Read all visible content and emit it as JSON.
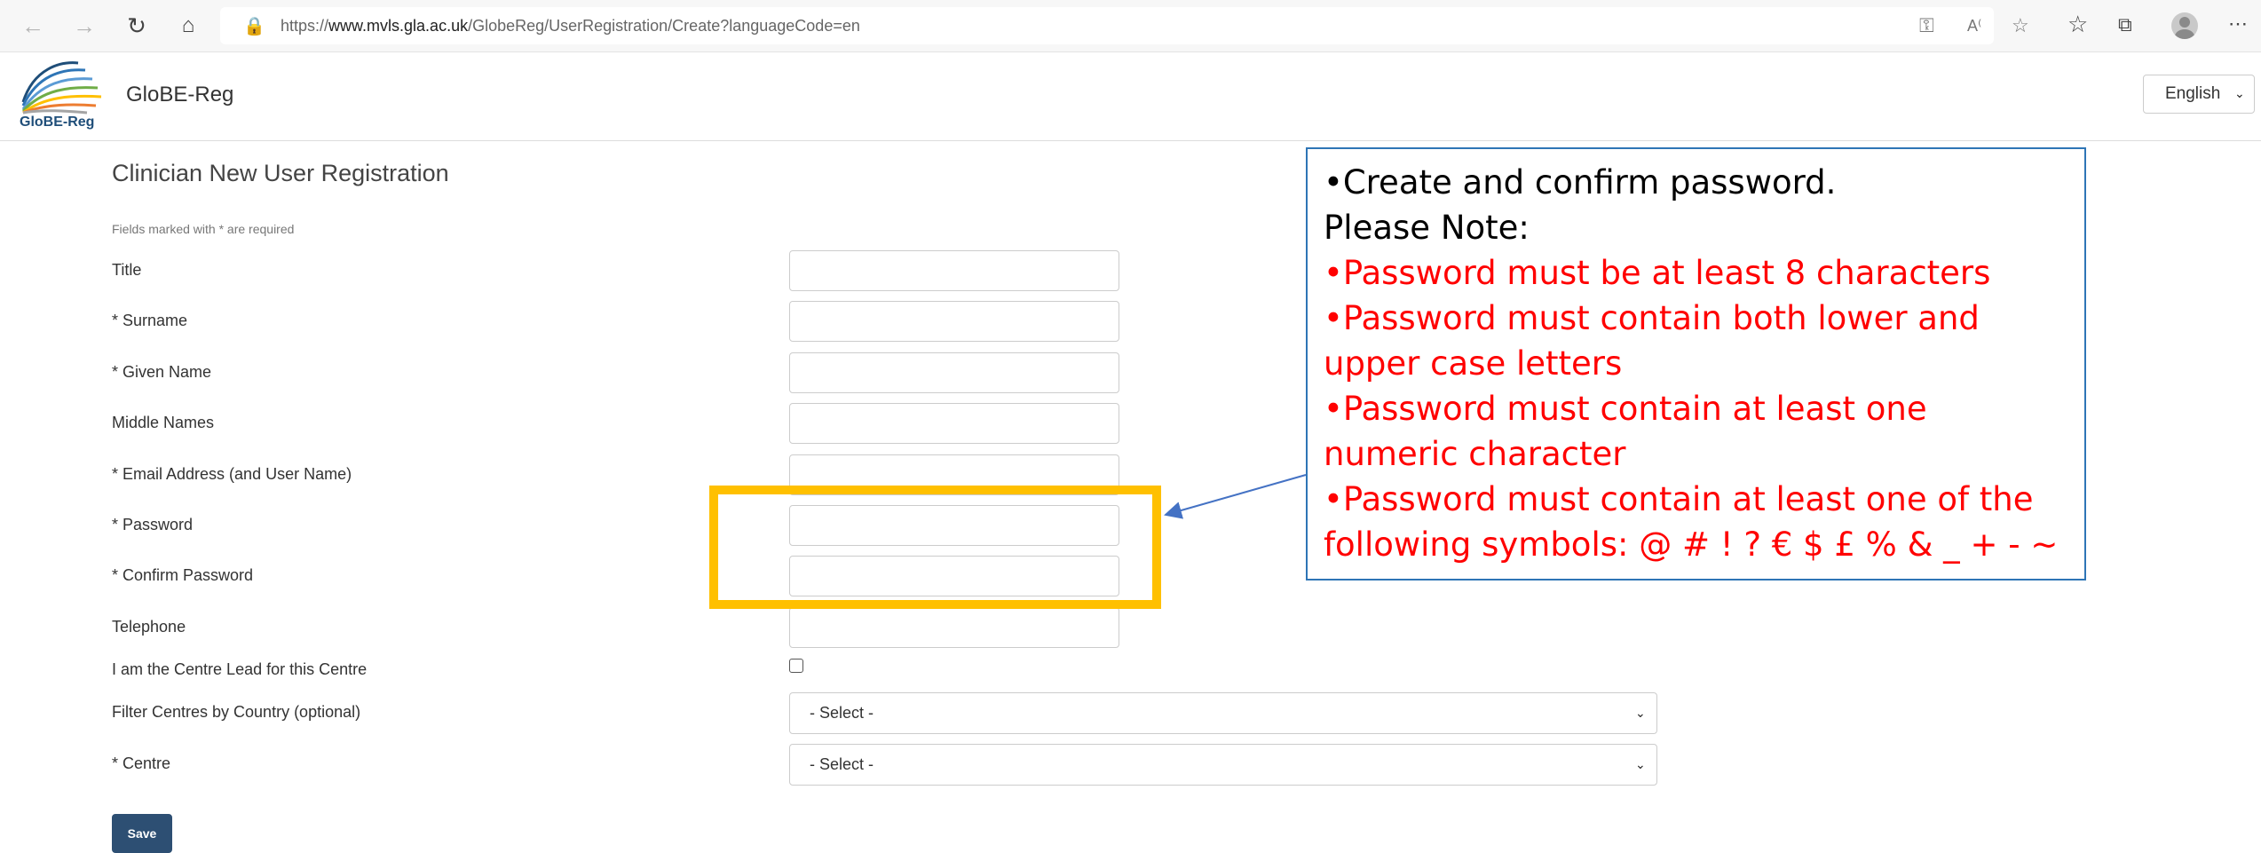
{
  "browser": {
    "url_prefix": "https://",
    "url_host": "www.mvls.gla.ac.uk",
    "url_path": "/GlobeReg/UserRegistration/Create?languageCode=en",
    "icons": [
      "back-icon",
      "forward-icon",
      "refresh-icon",
      "home-icon",
      "lock-icon",
      "key-icon",
      "read-aloud-icon",
      "favorite-add-icon",
      "favorites-icon",
      "collections-icon",
      "profile-icon",
      "more-icon"
    ]
  },
  "header": {
    "logo_text": "GloBE-Reg",
    "brand": "GloBE-Reg",
    "language": "English"
  },
  "form": {
    "title": "Clinician New User Registration",
    "required_note": "Fields marked with * are required",
    "labels": {
      "title": "Title",
      "surname": "* Surname",
      "given_name": "* Given Name",
      "middle_names": "Middle Names",
      "email": "* Email Address (and User Name)",
      "password": "* Password",
      "confirm_password": "* Confirm Password",
      "telephone": "Telephone",
      "centre_lead": "I am the Centre Lead for this Centre",
      "filter_country": "Filter Centres by Country (optional)",
      "centre": "* Centre"
    },
    "country_select": "- Select -",
    "centre_select": "- Select -",
    "save": "Save"
  },
  "annotation": {
    "line1": "•Create and confirm password.",
    "line2": "Please Note:",
    "rule1": "•Password must be at least 8 characters",
    "rule2a": "•Password must contain both lower and",
    "rule2b": "upper case letters",
    "rule3a": "•Password must contain at least one",
    "rule3b": "numeric character",
    "rule4a": "•Password must contain at least one of the",
    "rule4b": "following symbols: @ # ! ? € $ £ % & _ + - ~",
    "colors": {
      "highlight": "#ffc000",
      "border": "#2e75b6",
      "rules": "#ff0000"
    }
  }
}
